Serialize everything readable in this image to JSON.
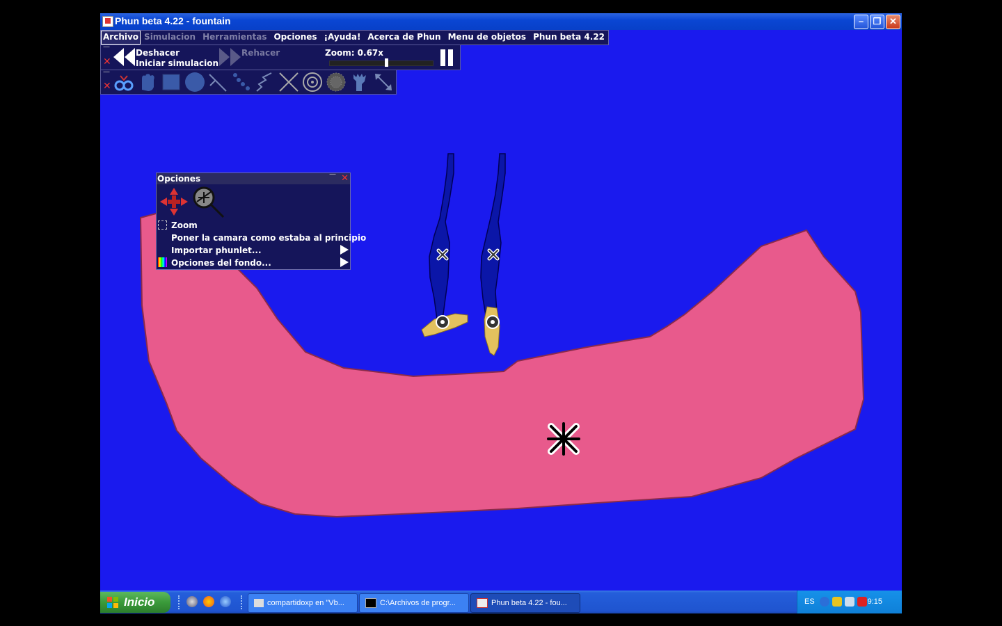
{
  "window": {
    "title": "Phun beta 4.22 - fountain"
  },
  "menubar": {
    "items": [
      {
        "label": "Archivo",
        "state": "selected"
      },
      {
        "label": "Simulacion",
        "state": "disabled"
      },
      {
        "label": "Herramientas",
        "state": "disabled"
      },
      {
        "label": "Opciones",
        "state": "normal"
      },
      {
        "label": "¡Ayuda!",
        "state": "normal"
      },
      {
        "label": "Acerca de Phun",
        "state": "normal"
      },
      {
        "label": "Menu de objetos",
        "state": "normal"
      },
      {
        "label": "Phun beta 4.22",
        "state": "normal"
      }
    ]
  },
  "toolbar": {
    "undo_label": "Deshacer",
    "start_sim_label": "Iniciar simulacion",
    "redo_label": "Rehacer",
    "zoom_label": "Zoom: 0.67x",
    "zoom_slider_fraction": 0.55
  },
  "tools": [
    "chain-tool",
    "drag-hand-tool",
    "box-tool",
    "circle-tool",
    "line-tool",
    "chain-links-tool",
    "spring-tool",
    "fixate-tool",
    "hinge-tool",
    "water-tool",
    "brush-hand-tool",
    "move-arrows-tool"
  ],
  "options_panel": {
    "title": "Opciones",
    "items": {
      "zoom": "Zoom",
      "reset_camera": "Poner la camara como estaba al principio",
      "import": "Importar phunlet...",
      "background": "Opciones del fondo..."
    }
  },
  "scene": {
    "background_color": "#1a1aee",
    "ground_color": "#e85a8c",
    "leg_color": "#0b16a8",
    "foot_color": "#e3c15e"
  },
  "taskbar": {
    "start_label": "Inicio",
    "tasks": [
      {
        "label": "compartidoxp en \"Vb...",
        "active": false
      },
      {
        "label": "C:\\Archivos de progr...",
        "active": false
      },
      {
        "label": "Phun beta 4.22 - fou...",
        "active": true
      }
    ],
    "lang": "ES",
    "clock": "9:15"
  }
}
